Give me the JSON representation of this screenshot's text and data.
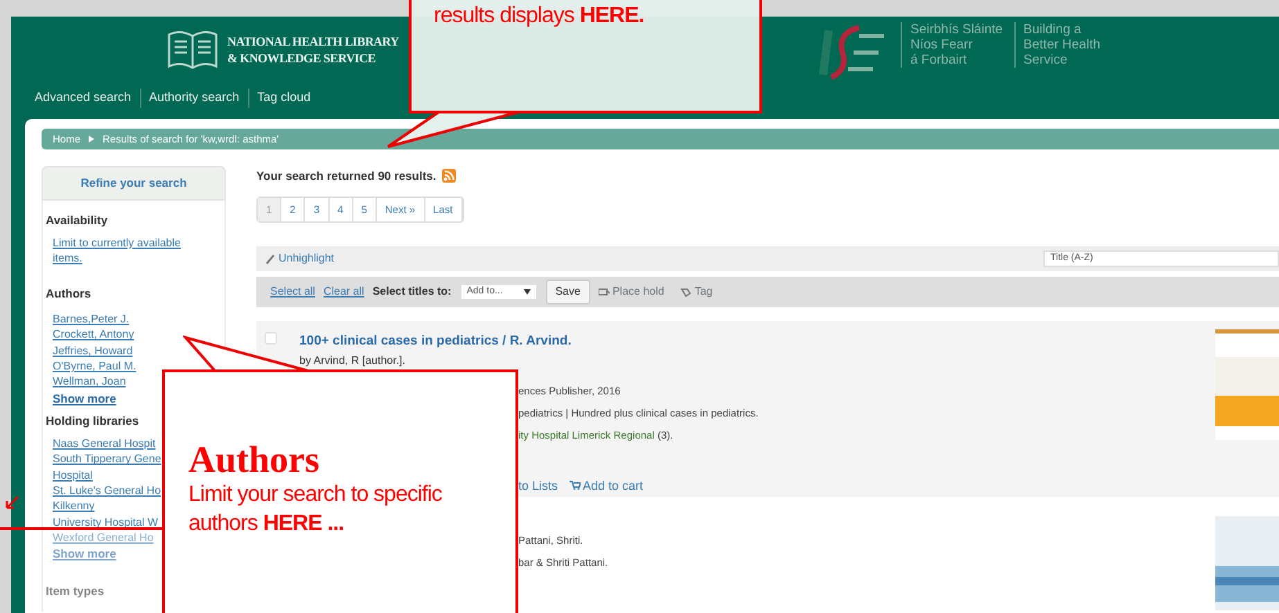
{
  "header": {
    "logo_lines": [
      "NATIONAL HEALTH LIBRARY",
      "& KNOWLEDGE SERVICE"
    ],
    "hse_text": [
      "Seirbhís Sláinte",
      "Níos Fearr",
      "á Forbairt"
    ],
    "hse_tagline": [
      "Building a",
      "Better Health",
      "Service"
    ],
    "nav": [
      "Advanced search",
      "Authority search",
      "Tag cloud"
    ]
  },
  "breadcrumb": [
    "Home",
    "Results of search for 'kw,wrdl: asthma'"
  ],
  "sidebar": {
    "title": "Refine your search",
    "sections": [
      {
        "heading": "Availability",
        "faded": false,
        "links": [
          {
            "text": "Limit to currently available items.",
            "faded": false
          }
        ]
      },
      {
        "heading": "Authors",
        "faded": false,
        "links": [
          {
            "text": "Barnes,Peter J.",
            "faded": false
          },
          {
            "text": "Crockett, Antony",
            "faded": false
          },
          {
            "text": "Jeffries, Howard",
            "faded": false
          },
          {
            "text": "O'Byrne, Paul M.",
            "faded": false
          },
          {
            "text": "Wellman, Joan",
            "faded": false
          }
        ],
        "show_more": {
          "text": "Show more",
          "faded": false
        }
      },
      {
        "heading": "Holding libraries",
        "faded": false,
        "links": [
          {
            "text": "Naas General Hospit",
            "faded": false
          },
          {
            "text": "South Tipperary Gene",
            "faded": false
          },
          {
            "text": "Hospital",
            "faded": false
          },
          {
            "text": "St. Luke's General Ho",
            "faded": false
          },
          {
            "text": "Kilkenny",
            "faded": false
          },
          {
            "text": "University Hospital W",
            "faded": false
          },
          {
            "text": "Wexford General Ho",
            "faded": true
          }
        ],
        "show_more": {
          "text": "Show more",
          "faded": true
        }
      },
      {
        "heading": "Item types",
        "faded": true
      }
    ]
  },
  "summary": "Your search returned 90 results.",
  "pagination": [
    {
      "label": "1",
      "selected": true
    },
    {
      "label": "2",
      "selected": false
    },
    {
      "label": "3",
      "selected": false
    },
    {
      "label": "4",
      "selected": false
    },
    {
      "label": "5",
      "selected": false
    },
    {
      "label": "Next »",
      "selected": false
    },
    {
      "label": "Last",
      "selected": false
    }
  ],
  "toolbar": {
    "unhighlight": "Unhighlight",
    "sort": "Title (A-Z)",
    "select_all": "Select all",
    "clear_all": "Clear all",
    "select_label": "Select titles to:",
    "add_to": "Add to...",
    "save": "Save",
    "place_hold": "Place hold",
    "tag": "Tag"
  },
  "results": [
    {
      "checked": false,
      "title": "100+ clinical cases in pediatrics / R. Arvind.",
      "author": "by Arvind, R [author.].",
      "lines": [
        "ences Publisher, 2016",
        "pediatrics | Hundred plus clinical cases in pediatrics."
      ],
      "availability": "ity Hospital Limerick Regional",
      "availability_count": " (3).",
      "actions": [
        "to Lists",
        "Add to cart"
      ]
    },
    {
      "lines": [
        "Pattani, Shriti.",
        "bar & Shriti Pattani."
      ]
    }
  ],
  "callouts": [
    {
      "kind": "top",
      "text": "results displays **HERE.**"
    },
    {
      "kind": "authors",
      "title": "Authors",
      "text": "Limit your search to specific authors **HERE ...**"
    }
  ]
}
